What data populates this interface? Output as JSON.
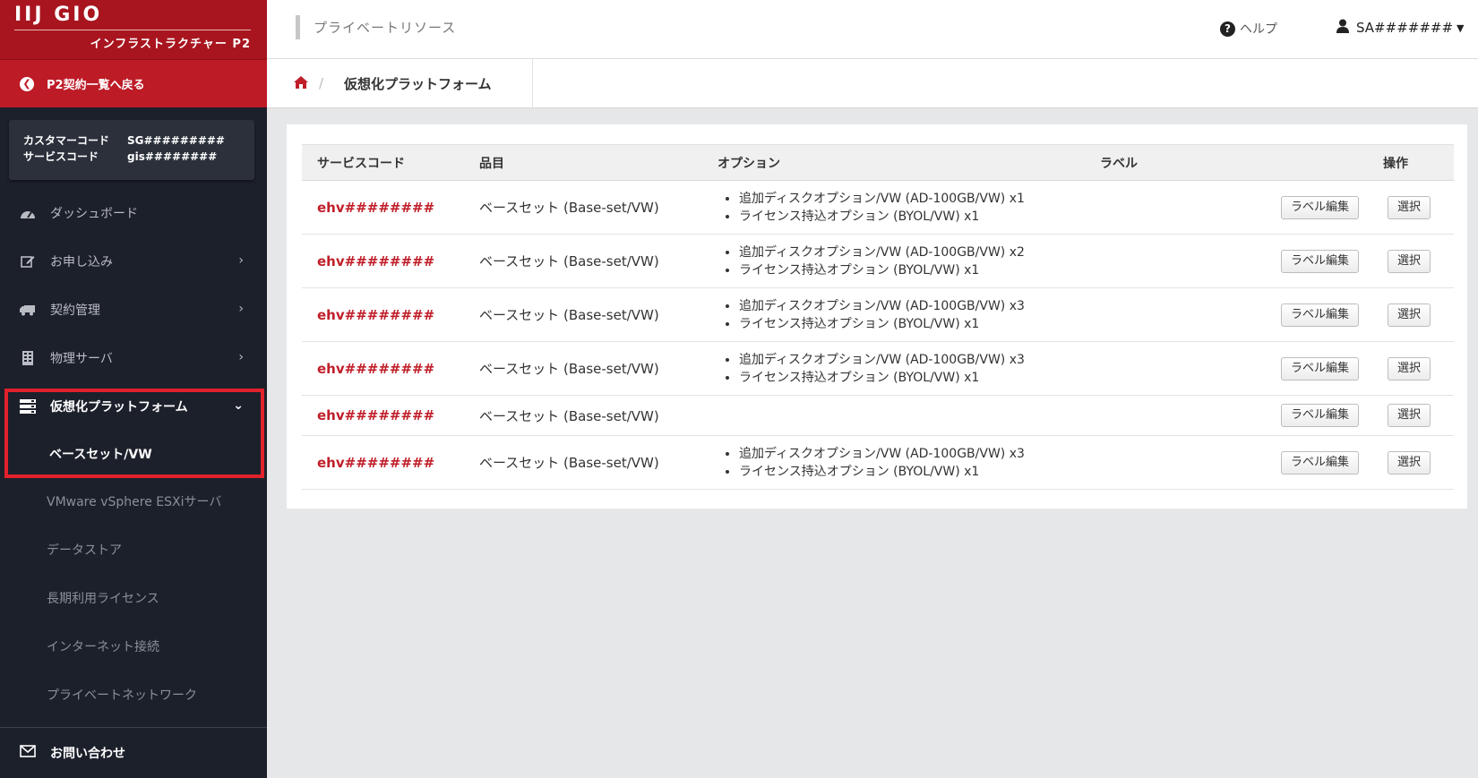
{
  "brand": {
    "logo": "IIJ GIO",
    "subtitle": "インフラストラクチャー P2"
  },
  "sidebar": {
    "back_label": "P2契約一覧へ戻る",
    "codes": [
      {
        "key": "カスタマーコード",
        "value": "SG#########"
      },
      {
        "key": "サービスコード",
        "value": "gis########"
      }
    ],
    "items": [
      {
        "label": "ダッシュボード"
      },
      {
        "label": "お申し込み"
      },
      {
        "label": "契約管理"
      },
      {
        "label": "物理サーバ"
      },
      {
        "label": "仮想化プラットフォーム"
      }
    ],
    "sub_items": [
      {
        "label": "ベースセット/VW"
      },
      {
        "label": "VMware vSphere ESXiサーバ"
      },
      {
        "label": "データストア"
      },
      {
        "label": "長期利用ライセンス"
      },
      {
        "label": "インターネット接続"
      },
      {
        "label": "プライベートネットワーク"
      }
    ],
    "bottom_label": "お問い合わせ"
  },
  "header": {
    "title": "プライベートリソース",
    "help_label": "ヘルプ",
    "user_label": "SA#######"
  },
  "breadcrumb": {
    "current": "仮想化プラットフォーム"
  },
  "table": {
    "columns": [
      "サービスコード",
      "品目",
      "オプション",
      "ラベル",
      "操作"
    ],
    "edit_label": "ラベル編集",
    "select_label": "選択",
    "rows": [
      {
        "code": "ehv########",
        "item": "ベースセット (Base-set/VW)",
        "options": [
          "追加ディスクオプション/VW (AD-100GB/VW) x1",
          "ライセンス持込オプション (BYOL/VW) x1"
        ]
      },
      {
        "code": "ehv########",
        "item": "ベースセット (Base-set/VW)",
        "options": [
          "追加ディスクオプション/VW (AD-100GB/VW) x2",
          "ライセンス持込オプション (BYOL/VW) x1"
        ]
      },
      {
        "code": "ehv########",
        "item": "ベースセット (Base-set/VW)",
        "options": [
          "追加ディスクオプション/VW (AD-100GB/VW) x3",
          "ライセンス持込オプション (BYOL/VW) x1"
        ]
      },
      {
        "code": "ehv########",
        "item": "ベースセット (Base-set/VW)",
        "options": [
          "追加ディスクオプション/VW (AD-100GB/VW) x3",
          "ライセンス持込オプション (BYOL/VW) x1"
        ]
      },
      {
        "code": "ehv########",
        "item": "ベースセット (Base-set/VW)",
        "options": []
      },
      {
        "code": "ehv########",
        "item": "ベースセット (Base-set/VW)",
        "options": [
          "追加ディスクオプション/VW (AD-100GB/VW) x3",
          "ライセンス持込オプション (BYOL/VW) x1"
        ]
      }
    ]
  },
  "colors": {
    "brand_red": "#a8151f",
    "sidebar_bg": "#1c202b",
    "link_red": "#c01f2a",
    "highlight": "#e1212b"
  }
}
